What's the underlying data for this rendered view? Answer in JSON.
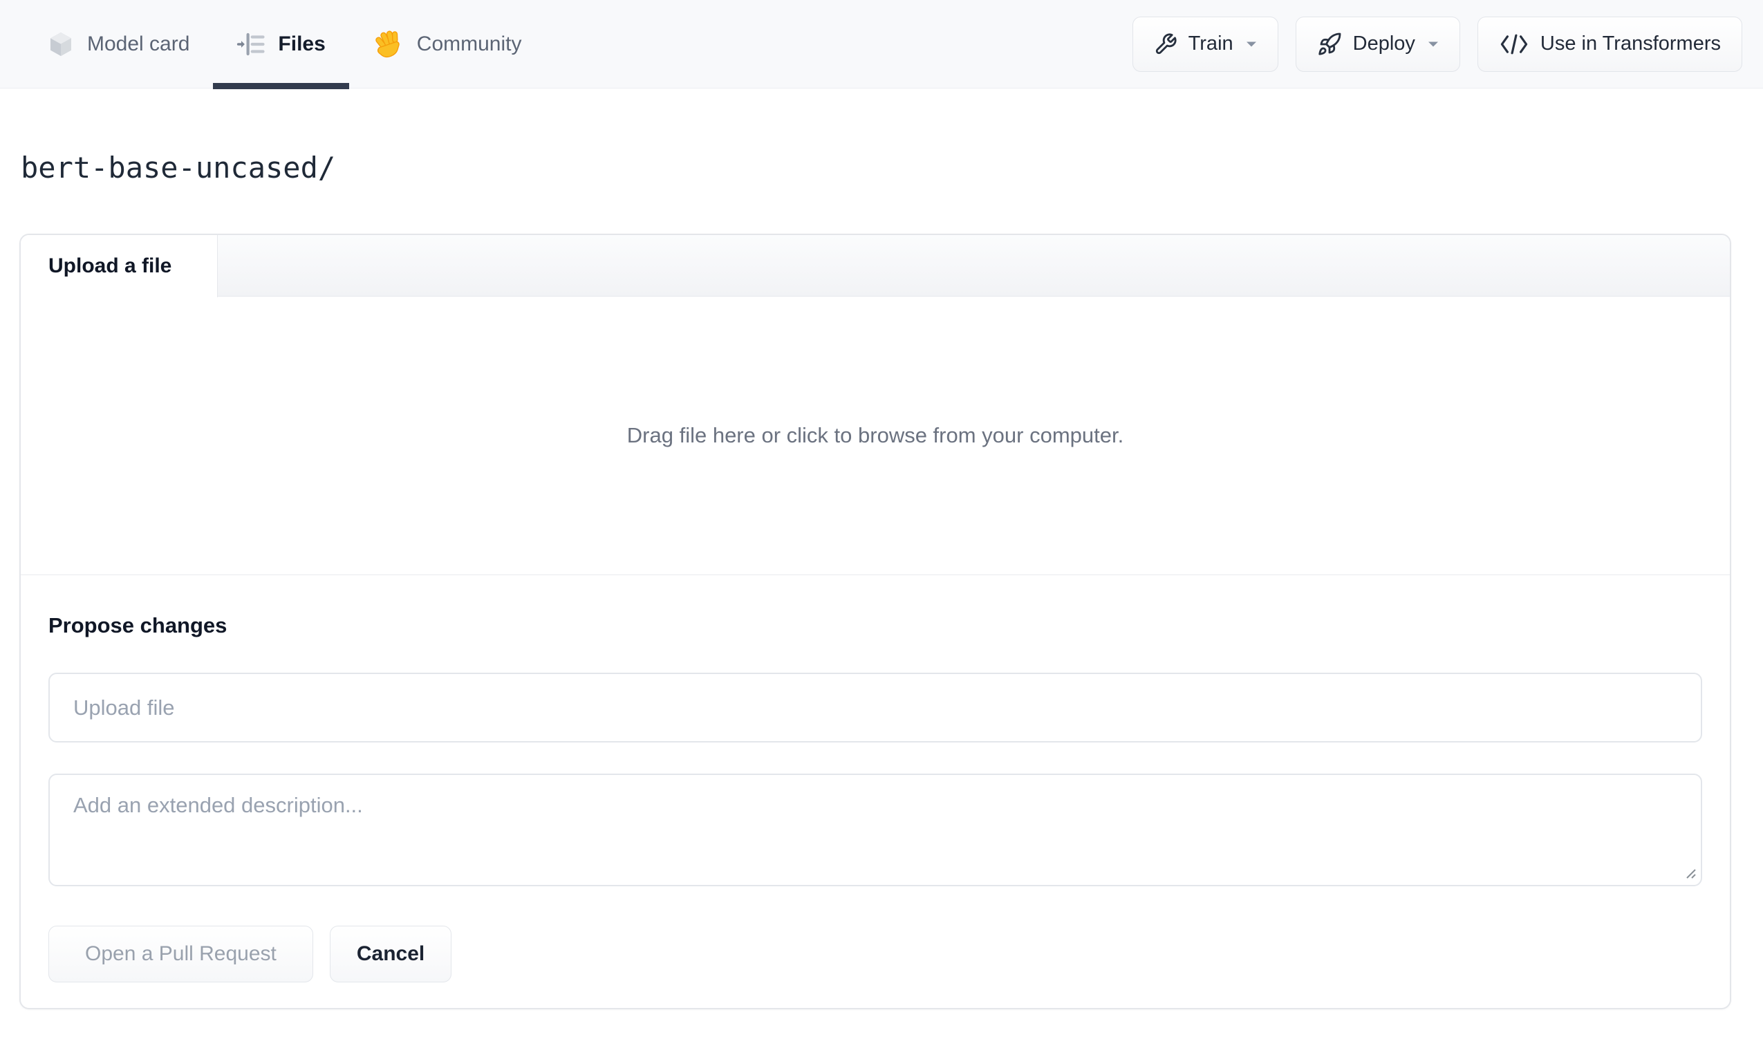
{
  "nav": {
    "tabs": [
      {
        "label": "Model card",
        "icon": "cube-icon",
        "active": false
      },
      {
        "label": "Files",
        "icon": "files-list-icon",
        "active": true
      },
      {
        "label": "Community",
        "icon": "waving-hand-icon",
        "active": false
      }
    ],
    "actions": [
      {
        "label": "Train",
        "icon": "wrench-icon",
        "has_caret": true
      },
      {
        "label": "Deploy",
        "icon": "rocket-icon",
        "has_caret": true
      },
      {
        "label": "Use in Transformers",
        "icon": "code-icon",
        "has_caret": false
      }
    ]
  },
  "breadcrumb": {
    "path": "bert-base-uncased/"
  },
  "upload_card": {
    "tab_label": "Upload a file",
    "dropzone_text": "Drag file here or click to browse from your computer.",
    "propose": {
      "heading": "Propose changes",
      "filename_placeholder": "Upload file",
      "description_placeholder": "Add an extended description...",
      "open_pr_label": "Open a Pull Request",
      "cancel_label": "Cancel"
    }
  },
  "colors": {
    "nav_background": "#f8f9fb",
    "active_tab_underline": "#333c4e",
    "card_border": "#e4e6ea",
    "muted_text": "#6b7280",
    "placeholder_text": "#99a2b0",
    "disabled_button_text": "#99a1ad",
    "dark_text": "#141c2b"
  }
}
